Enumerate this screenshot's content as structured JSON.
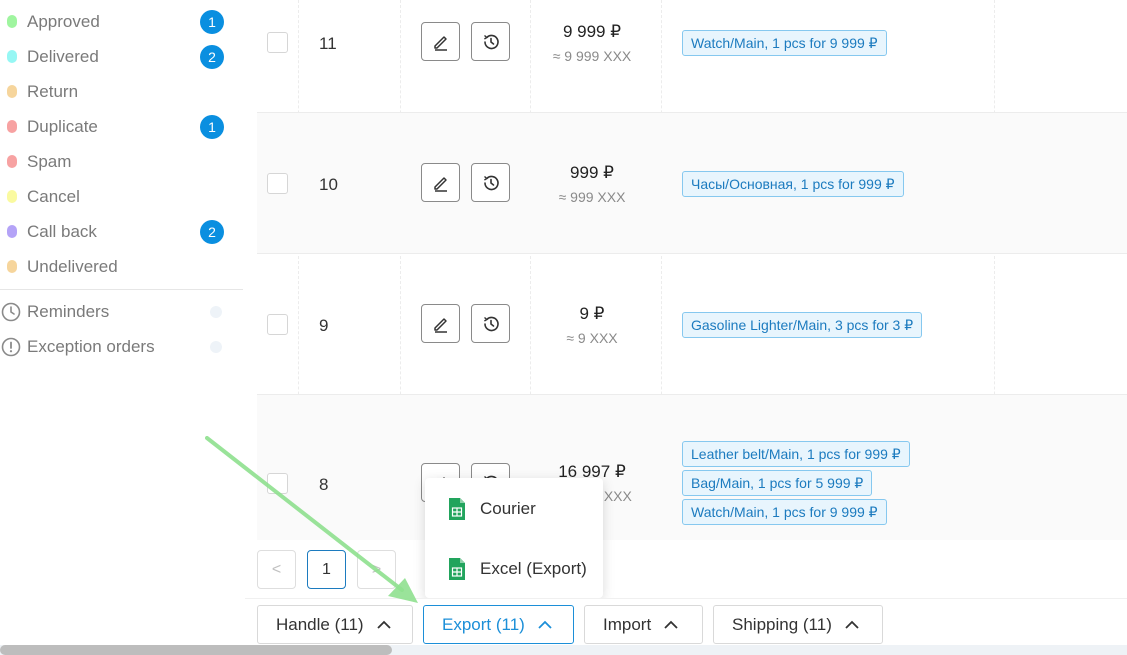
{
  "sidebar": {
    "statuses": [
      {
        "label": "Approved",
        "count": "1",
        "color": "#9ff59f"
      },
      {
        "label": "Delivered",
        "count": "2",
        "color": "#96f7f4"
      },
      {
        "label": "Return",
        "count": "",
        "color": "#f6d59c"
      },
      {
        "label": "Duplicate",
        "count": "1",
        "color": "#f7a2a2"
      },
      {
        "label": "Spam",
        "count": "",
        "color": "#f7a2a2"
      },
      {
        "label": "Cancel",
        "count": "",
        "color": "#fafaa0"
      },
      {
        "label": "Call back",
        "count": "2",
        "color": "#b4a3f7"
      },
      {
        "label": "Undelivered",
        "count": "",
        "color": "#f6d59c"
      }
    ],
    "links": [
      {
        "label": "Reminders",
        "icon": "clock-icon"
      },
      {
        "label": "Exception orders",
        "icon": "alert-circle-icon"
      }
    ]
  },
  "orders": [
    {
      "id": "11",
      "price": "9 999 ₽",
      "price_approx": "≈ 9 999 XXX",
      "products": [
        "Watch/Main, 1 pcs for 9 999 ₽"
      ]
    },
    {
      "id": "10",
      "price": "999 ₽",
      "price_approx": "≈ 999 XXX",
      "products": [
        "Часы/Основная, 1 pcs for 999 ₽"
      ]
    },
    {
      "id": "9",
      "price": "9 ₽",
      "price_approx": "≈ 9 XXX",
      "products": [
        "Gasoline Lighter/Main, 3 pcs for 3 ₽"
      ]
    },
    {
      "id": "8",
      "price": "16 997 ₽",
      "price_approx": "7 XXX",
      "products": [
        "Leather belt/Main, 1 pcs for 999 ₽",
        "Bag/Main, 1 pcs for 5 999 ₽",
        "Watch/Main, 1 pcs for 9 999 ₽"
      ]
    }
  ],
  "pagination": {
    "prev": "<",
    "current": "1",
    "next": ">"
  },
  "actions": {
    "handle": "Handle (11)",
    "export": "Export (11)",
    "import": "Import",
    "shipping": "Shipping (11)"
  },
  "export_menu": {
    "items": [
      "Courier",
      "Excel (Export)"
    ]
  },
  "colors": {
    "accent": "#1c8fd8",
    "badge": "#0a8fe0",
    "tag_border": "#86c8ef",
    "tag_bg": "#e8f5fd",
    "spreadsheet_icon": "#22a45d",
    "arrow": "#8fe08f"
  }
}
